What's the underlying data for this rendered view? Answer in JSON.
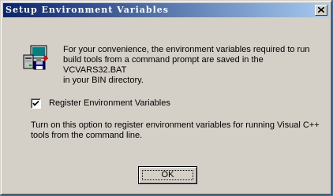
{
  "window": {
    "title": "Setup Environment Variables"
  },
  "icons": {
    "close": "close-icon",
    "setup": "computer-setup-icon",
    "checkmark": "checkmark-icon"
  },
  "dialog": {
    "intro_line1": "For your convenience, the environment variables required to run",
    "intro_line2": "build tools from a command prompt are saved in the VCVARS32.BAT",
    "intro_line3": "in your BIN directory.",
    "checkbox_label": "Register Environment Variables",
    "checkbox_checked": true,
    "help_line1": "Turn on this option to register environment variables for running Visual C++",
    "help_line2": "tools from the command line.",
    "ok_label": "OK"
  },
  "colors": {
    "titlebar_start": "#0a246a",
    "titlebar_end": "#a6caf0",
    "face": "#d4d0c8",
    "desktop": "#1f7db6"
  }
}
